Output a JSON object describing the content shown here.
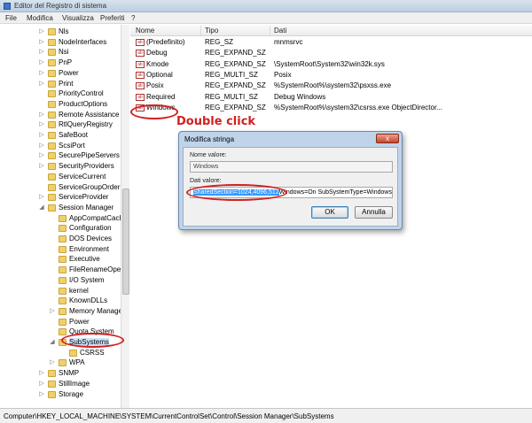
{
  "window": {
    "title": "Editor del Registro di sistema"
  },
  "menu": [
    "File",
    "Modifica",
    "Visualizza",
    "Preferiti",
    "?"
  ],
  "tree": {
    "items": [
      {
        "label": "Nls",
        "depth": 0,
        "expander": "▷"
      },
      {
        "label": "NodeInterfaces",
        "depth": 0,
        "expander": "▷"
      },
      {
        "label": "Nsi",
        "depth": 0,
        "expander": "▷"
      },
      {
        "label": "PnP",
        "depth": 0,
        "expander": "▷"
      },
      {
        "label": "Power",
        "depth": 0,
        "expander": "▷"
      },
      {
        "label": "Print",
        "depth": 0,
        "expander": "▷"
      },
      {
        "label": "PriorityControl",
        "depth": 0,
        "expander": ""
      },
      {
        "label": "ProductOptions",
        "depth": 0,
        "expander": ""
      },
      {
        "label": "Remote Assistance",
        "depth": 0,
        "expander": "▷"
      },
      {
        "label": "RtlQueryRegistry",
        "depth": 0,
        "expander": "▷"
      },
      {
        "label": "SafeBoot",
        "depth": 0,
        "expander": "▷"
      },
      {
        "label": "ScsiPort",
        "depth": 0,
        "expander": "▷"
      },
      {
        "label": "SecurePipeServers",
        "depth": 0,
        "expander": "▷"
      },
      {
        "label": "SecurityProviders",
        "depth": 0,
        "expander": "▷"
      },
      {
        "label": "ServiceCurrent",
        "depth": 0,
        "expander": ""
      },
      {
        "label": "ServiceGroupOrder",
        "depth": 0,
        "expander": ""
      },
      {
        "label": "ServiceProvider",
        "depth": 0,
        "expander": "▷"
      },
      {
        "label": "Session Manager",
        "depth": 0,
        "expander": "◢"
      },
      {
        "label": "AppCompatCache",
        "depth": 1,
        "expander": ""
      },
      {
        "label": "Configuration",
        "depth": 1,
        "expander": ""
      },
      {
        "label": "DOS Devices",
        "depth": 1,
        "expander": ""
      },
      {
        "label": "Environment",
        "depth": 1,
        "expander": ""
      },
      {
        "label": "Executive",
        "depth": 1,
        "expander": ""
      },
      {
        "label": "FileRenameOperations",
        "depth": 1,
        "expander": ""
      },
      {
        "label": "I/O System",
        "depth": 1,
        "expander": ""
      },
      {
        "label": "kernel",
        "depth": 1,
        "expander": ""
      },
      {
        "label": "KnownDLLs",
        "depth": 1,
        "expander": ""
      },
      {
        "label": "Memory Management",
        "depth": 1,
        "expander": "▷"
      },
      {
        "label": "Power",
        "depth": 1,
        "expander": ""
      },
      {
        "label": "Quota System",
        "depth": 1,
        "expander": ""
      },
      {
        "label": "SubSystems",
        "depth": 1,
        "expander": "◢",
        "selected": true
      },
      {
        "label": "CSRSS",
        "depth": 2,
        "expander": ""
      },
      {
        "label": "WPA",
        "depth": 1,
        "expander": "▷"
      },
      {
        "label": "SNMP",
        "depth": 0,
        "expander": "▷"
      },
      {
        "label": "StillImage",
        "depth": 0,
        "expander": "▷"
      },
      {
        "label": "Storage",
        "depth": 0,
        "expander": "▷"
      }
    ]
  },
  "list": {
    "columns": [
      "Nome",
      "Tipo",
      "Dati"
    ],
    "rows": [
      {
        "name": "(Predefinito)",
        "type": "REG_SZ",
        "data": "mnmsrvc"
      },
      {
        "name": "Debug",
        "type": "REG_EXPAND_SZ",
        "data": ""
      },
      {
        "name": "Kmode",
        "type": "REG_EXPAND_SZ",
        "data": "\\SystemRoot\\System32\\win32k.sys"
      },
      {
        "name": "Optional",
        "type": "REG_MULTI_SZ",
        "data": "Posix"
      },
      {
        "name": "Posix",
        "type": "REG_EXPAND_SZ",
        "data": "%SystemRoot%\\system32\\psxss.exe"
      },
      {
        "name": "Required",
        "type": "REG_MULTI_SZ",
        "data": "Debug Windows"
      },
      {
        "name": "Windows",
        "type": "REG_EXPAND_SZ",
        "data": "%SystemRoot%\\system32\\csrss.exe ObjectDirector..."
      }
    ]
  },
  "annotation": {
    "text": "Double click",
    "color": "#d02020"
  },
  "dialog": {
    "title": "Modifica stringa",
    "close_label": "x",
    "value_name_label": "Nome valore:",
    "value_name": "Windows",
    "value_data_label": "Dati valore:",
    "value_data_highlight": "SharedSection=1024,4096,512",
    "value_data_rest": "Windows=On SubSystemType=Windows",
    "ok_label": "OK",
    "cancel_label": "Annulla"
  },
  "status": {
    "path": "Computer\\HKEY_LOCAL_MACHINE\\SYSTEM\\CurrentControlSet\\Control\\Session Manager\\SubSystems"
  },
  "colors": {
    "accent": "#3399ff",
    "annotation": "#d02020",
    "folder": "#efd06a"
  }
}
